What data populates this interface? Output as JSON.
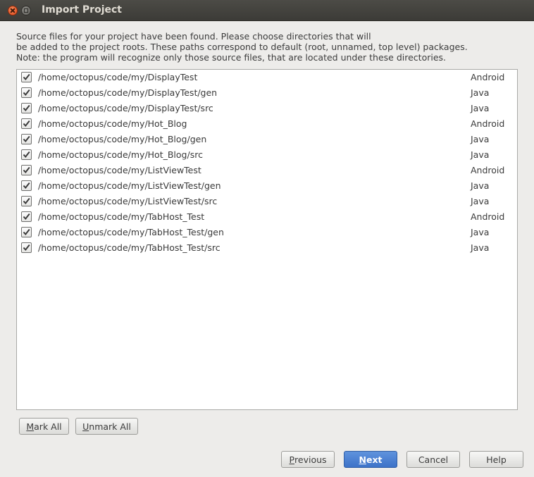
{
  "window": {
    "title": "Import Project"
  },
  "description": {
    "line1": "Source files for your project have been found. Please choose directories that will",
    "line2": "be added to the project roots. These paths correspond to default (root, unnamed, top level) packages.",
    "line3": "Note: the program will recognize only those source files, that are located under these directories."
  },
  "roots": [
    {
      "path": "/home/octopus/code/my/DisplayTest",
      "type": "Android",
      "checked": true
    },
    {
      "path": "/home/octopus/code/my/DisplayTest/gen",
      "type": "Java",
      "checked": true
    },
    {
      "path": "/home/octopus/code/my/DisplayTest/src",
      "type": "Java",
      "checked": true
    },
    {
      "path": "/home/octopus/code/my/Hot_Blog",
      "type": "Android",
      "checked": true
    },
    {
      "path": "/home/octopus/code/my/Hot_Blog/gen",
      "type": "Java",
      "checked": true
    },
    {
      "path": "/home/octopus/code/my/Hot_Blog/src",
      "type": "Java",
      "checked": true
    },
    {
      "path": "/home/octopus/code/my/ListViewTest",
      "type": "Android",
      "checked": true
    },
    {
      "path": "/home/octopus/code/my/ListViewTest/gen",
      "type": "Java",
      "checked": true
    },
    {
      "path": "/home/octopus/code/my/ListViewTest/src",
      "type": "Java",
      "checked": true
    },
    {
      "path": "/home/octopus/code/my/TabHost_Test",
      "type": "Android",
      "checked": true
    },
    {
      "path": "/home/octopus/code/my/TabHost_Test/gen",
      "type": "Java",
      "checked": true
    },
    {
      "path": "/home/octopus/code/my/TabHost_Test/src",
      "type": "Java",
      "checked": true
    }
  ],
  "buttons": {
    "mark_all": {
      "mnemonic": "M",
      "rest": "ark All"
    },
    "unmark_all": {
      "mnemonic": "U",
      "rest": "nmark All"
    },
    "previous": {
      "mnemonic": "P",
      "rest": "revious"
    },
    "next": {
      "mnemonic": "N",
      "rest": "ext"
    },
    "cancel": "Cancel",
    "help": "Help"
  },
  "colors": {
    "primary_button": "#3d72c8",
    "titlebar": "#3c3b37",
    "close_button": "#e0491b"
  },
  "icons": {
    "close": "close-icon",
    "maximize": "maximize-icon",
    "checkbox": "checkmark-icon"
  }
}
